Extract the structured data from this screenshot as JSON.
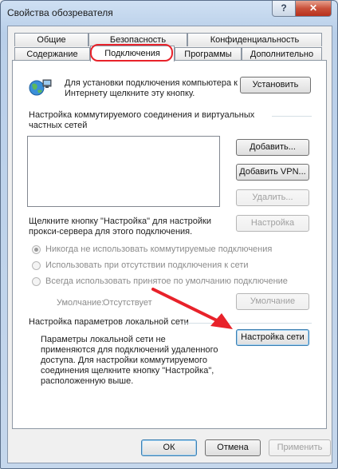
{
  "window": {
    "title": "Свойства обозревателя",
    "help_label": "?",
    "close_label": "✕"
  },
  "tabs": {
    "row1": [
      "Общие",
      "Безопасность",
      "Конфиденциальность"
    ],
    "row2": [
      "Содержание",
      "Подключения",
      "Программы",
      "Дополнительно"
    ],
    "active": "Подключения"
  },
  "setup": {
    "text": "Для установки подключения компьютера к Интернету щелкните эту кнопку.",
    "button": "Установить"
  },
  "dialup": {
    "heading": "Настройка коммутируемого соединения и виртуальных частных сетей",
    "add_button": "Добавить...",
    "add_vpn_button": "Добавить VPN...",
    "remove_button": "Удалить...",
    "proxy_text": "Щелкните кнопку \"Настройка\" для настройки прокси-сервера для этого подключения.",
    "settings_button": "Настройка",
    "options": [
      "Никогда не использовать коммутируемые подключения",
      "Использовать при отсутствии подключения к сети",
      "Всегда использовать принятое по умолчанию подключение"
    ],
    "selected_option": 0,
    "default_label": "Умолчание:",
    "default_value": "Отсутствует",
    "default_button": "Умолчание"
  },
  "lan": {
    "heading": "Настройка параметров локальной сети",
    "text": "Параметры локальной сети не применяются для подключений удаленного доступа. Для настройки коммутируемого соединения щелкните кнопку \"Настройка\", расположенную выше.",
    "button": "Настройка сети"
  },
  "footer": {
    "ok": "ОК",
    "cancel": "Отмена",
    "apply": "Применить"
  },
  "colors": {
    "highlight_ring": "#e8222a",
    "arrow": "#e8222a"
  }
}
